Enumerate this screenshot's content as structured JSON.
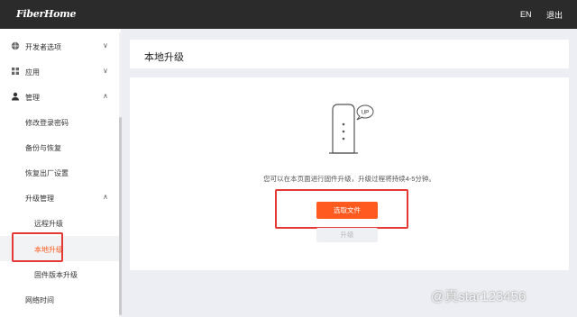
{
  "header": {
    "logo": "FiberHome",
    "lang": "EN",
    "logout": "退出"
  },
  "sidebar": {
    "items": [
      {
        "label": "开发者选项",
        "icon": "globe-icon",
        "chevron": "∨"
      },
      {
        "label": "应用",
        "icon": "apps-icon",
        "chevron": "∨"
      },
      {
        "label": "管理",
        "icon": "user-icon",
        "chevron": "∧"
      },
      {
        "label": "修改登录密码"
      },
      {
        "label": "备份与恢复"
      },
      {
        "label": "恢复出厂设置"
      },
      {
        "label": "升级管理",
        "chevron": "∧"
      },
      {
        "label": "远程升级"
      },
      {
        "label": "本地升级"
      },
      {
        "label": "固件版本升级"
      },
      {
        "label": "网络时间"
      }
    ]
  },
  "main": {
    "title": "本地升级",
    "illustration_badge": "UP",
    "description": "您可以在本页面进行固件升级，升级过程将持续4-5分钟。",
    "select_file_label": "选取文件",
    "upgrade_label": "升级"
  },
  "watermark": "@真star123456",
  "colors": {
    "accent": "#ff5a1f",
    "topbar": "#2b2b2b",
    "highlight": "#e53935"
  }
}
